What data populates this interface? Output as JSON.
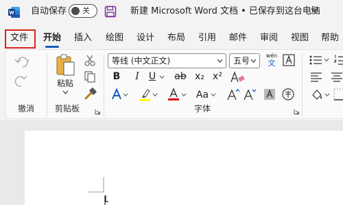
{
  "titlebar": {
    "autosave_label": "自动保存",
    "autosave_state": "关",
    "document_title": "新建 Microsoft Word 文档 • 已保存到这台电脑"
  },
  "tabs": [
    "文件",
    "开始",
    "插入",
    "绘图",
    "设计",
    "布局",
    "引用",
    "邮件",
    "审阅",
    "视图",
    "帮助"
  ],
  "active_tab": "开始",
  "ribbon": {
    "undo_group_label": "撤消",
    "clipboard": {
      "paste_label": "粘贴",
      "group_label": "剪贴板"
    },
    "font": {
      "font_name": "等线 (中文正文)",
      "font_size": "五号",
      "phonetic_top": "wén",
      "phonetic_bottom": "文",
      "bold": "B",
      "italic": "I",
      "underline": "U",
      "strike": "ab",
      "subscript": "x₂",
      "superscript": "x²",
      "change_case": "Aa",
      "group_label": "字体"
    }
  },
  "colors": {
    "accent": "#185abd",
    "highlight_color": "#ffff00",
    "font_color": "#e00000",
    "file_tab_outline": "#d9241b"
  }
}
